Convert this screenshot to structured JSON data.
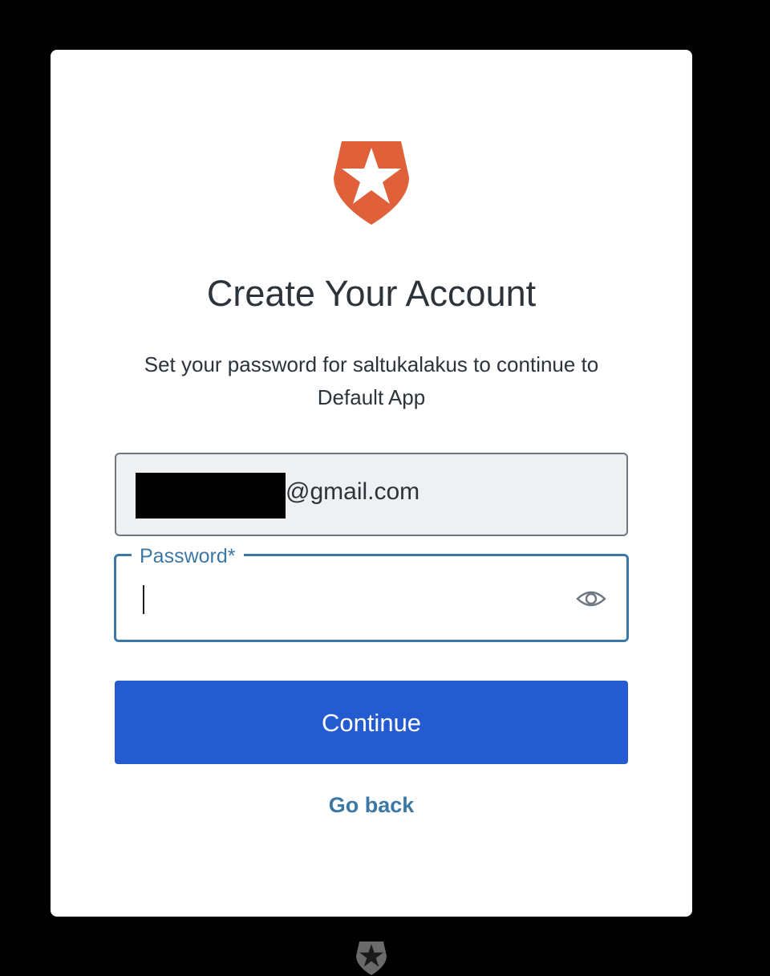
{
  "header": {
    "title": "Create Your Account",
    "subtitle_line1": "Set your password for saltukalakus to continue to",
    "subtitle_line2": "Default App"
  },
  "form": {
    "email_value_visible": "@gmail.com",
    "password_label": "Password*",
    "password_value": ""
  },
  "actions": {
    "continue_label": "Continue",
    "go_back_label": "Go back"
  },
  "icons": {
    "logo": "shield-star-logo",
    "password_toggle": "eye-icon",
    "footer": "shield-star-logo"
  },
  "colors": {
    "brand_orange": "#e0603a",
    "primary_button": "#245bd1",
    "link": "#3c78a6",
    "focus_border": "#3c78a6",
    "email_field_bg": "#eff0f2",
    "page_bg": "#000000"
  }
}
